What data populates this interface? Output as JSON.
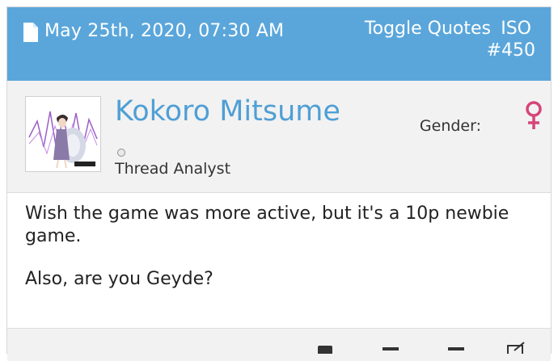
{
  "header": {
    "date": "May 25th, 2020, 07:30 AM",
    "toggle_quotes": "Toggle Quotes",
    "iso": "ISO",
    "post_number": "#450"
  },
  "user": {
    "name": "Kokoro Mitsume",
    "rank": "Thread Analyst",
    "gender_label": "Gender:",
    "gender_icon": "female-symbol"
  },
  "post": {
    "lines": [
      "Wish the game was more active, but it's a 10p newbie",
      "game.",
      "Also, are you Geyde?"
    ]
  },
  "colors": {
    "header_bg": "#5aa6db",
    "username": "#4f9fd5",
    "gender_icon": "#d6457a"
  }
}
